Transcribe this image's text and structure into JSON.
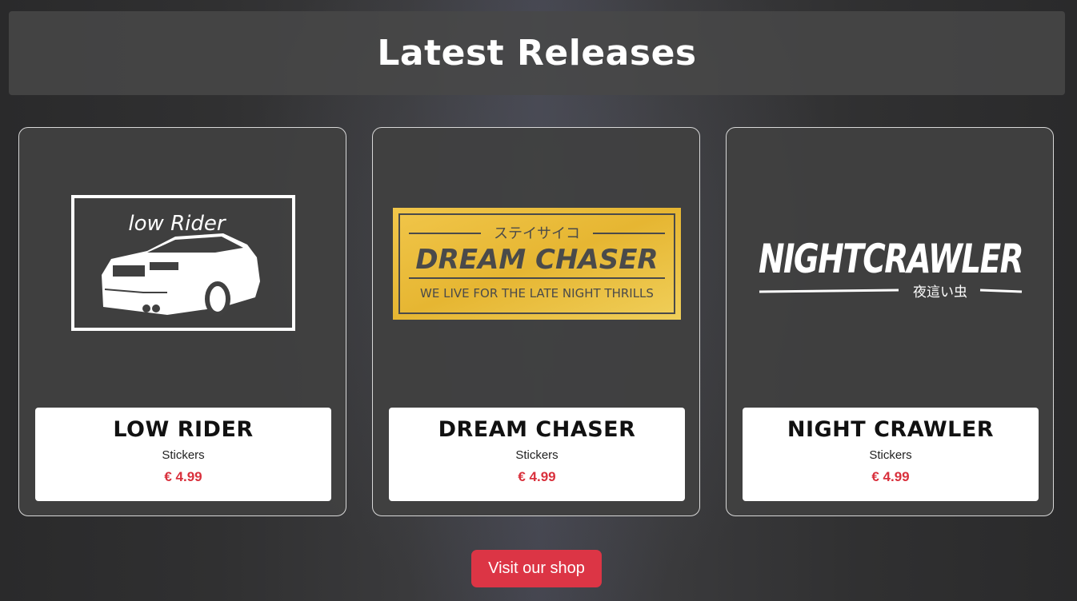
{
  "header": {
    "title": "Latest Releases"
  },
  "products": [
    {
      "name": "LOW RIDER",
      "category": "Stickers",
      "price": "€ 4.99",
      "art_text": "low Rider"
    },
    {
      "name": "DREAM CHASER",
      "category": "Stickers",
      "price": "€ 4.99",
      "art_kana": "ステイサイコ",
      "art_text": "DREAM CHASER",
      "art_tagline": "WE LIVE FOR THE LATE NIGHT THRILLS"
    },
    {
      "name": "NIGHT CRAWLER",
      "category": "Stickers",
      "price": "€ 4.99",
      "art_text": "NIGHTCRAWLER",
      "art_kana": "夜這い虫"
    }
  ],
  "cta": {
    "label": "Visit our shop"
  },
  "colors": {
    "accent": "#dc3545",
    "price": "#d9303c",
    "gold": "#e9b93a"
  }
}
